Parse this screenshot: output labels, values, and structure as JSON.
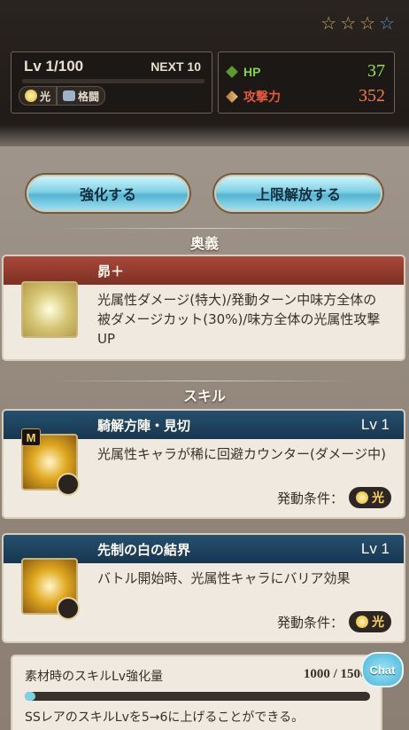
{
  "rarity_stars": {
    "filled": 3,
    "total": 4
  },
  "level": {
    "text": "Lv 1/100",
    "next_label": "NEXT 10"
  },
  "attributes": {
    "element": "光",
    "type": "格闘"
  },
  "stats": {
    "hp_label": "HP",
    "hp_value": "37",
    "atk_label": "攻撃力",
    "atk_value": "352"
  },
  "buttons": {
    "upgrade": "強化する",
    "uncap": "上限解放する"
  },
  "sections": {
    "ougi": "奥義",
    "skill": "スキル"
  },
  "ougi": {
    "name": "昴＋",
    "desc": "光属性ダメージ(特大)/発動ターン中味方全体の被ダメージカット(30%)/味方全体の光属性攻撃UP"
  },
  "skills": [
    {
      "name": "騎解方陣・見切",
      "level": "Lv 1",
      "desc": "光属性キャラが稀に回避カウンター(ダメージ中)",
      "cond_label": "発動条件：",
      "cond_value": "光",
      "tag": "M"
    },
    {
      "name": "先制の白の結界",
      "level": "Lv 1",
      "desc": "バトル開始時、光属性キャラにバリア効果",
      "cond_label": "発動条件：",
      "cond_value": "光"
    }
  ],
  "material": {
    "label": "素材時のスキルLv強化量",
    "value": "1000 / 15000",
    "desc": "SSレアのスキルLvを5→6に上げることができる。"
  },
  "chat": {
    "label": "Chat"
  }
}
